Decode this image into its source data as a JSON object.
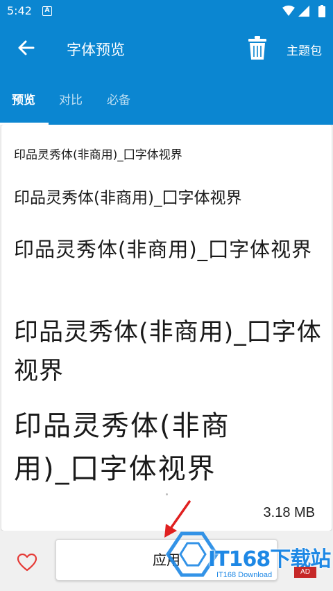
{
  "status_bar": {
    "time": "5:42",
    "notification_badge": "A",
    "icons": [
      "wifi-icon",
      "signal-icon",
      "battery-icon"
    ]
  },
  "app_bar": {
    "title": "字体预览",
    "theme_label": "主题包",
    "icons": [
      "back-arrow-icon",
      "trash-icon"
    ],
    "background_color": "#0b86d1"
  },
  "tabs": [
    {
      "label": "预览",
      "active": true
    },
    {
      "label": "对比",
      "active": false
    },
    {
      "label": "必备",
      "active": false
    }
  ],
  "preview": {
    "samples": [
      "印品灵秀体(非商用)_囗字体视界",
      "印品灵秀体(非商用)_囗字体视界",
      "印品灵秀体(非商用)_囗字体视界",
      "印品灵秀体(非商用)_囗字体视界",
      "印品灵秀体(非商用)_囗字体视界"
    ],
    "file_size": "3.18 MB"
  },
  "bottom_bar": {
    "apply_label": "应用",
    "favorite_icon": "heart-outline-icon",
    "accent_color": "#e53935"
  },
  "watermark": {
    "text": "IT168下载站",
    "subtext": "IT168 Download",
    "badge": "AD"
  }
}
